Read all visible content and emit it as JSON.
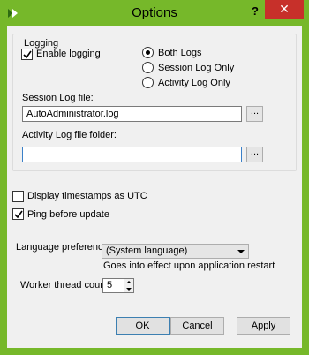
{
  "window": {
    "title": "Options",
    "help_label": "?",
    "close_label": "✕",
    "app_icon": "app-icon",
    "frame_color": "#76b82a",
    "close_color": "#c7302a"
  },
  "logging": {
    "group_title": "Logging",
    "enable_label": "Enable logging",
    "enable_checked": true,
    "radios": [
      {
        "label": "Both Logs",
        "selected": true
      },
      {
        "label": "Session Log Only",
        "selected": false
      },
      {
        "label": "Activity Log Only",
        "selected": false
      }
    ],
    "session_label": "Session Log file:",
    "session_value": "AutoAdministrator.log",
    "activity_label": "Activity Log file folder:",
    "activity_value": "",
    "browse_label": "..."
  },
  "options": {
    "utc_label": "Display timestamps as UTC",
    "utc_checked": false,
    "ping_label": "Ping before update",
    "ping_checked": true,
    "language_label": "Language preference:",
    "language_value": "(System language)",
    "language_note": "Goes into effect upon application restart",
    "worker_label": "Worker thread count:",
    "worker_value": "5"
  },
  "buttons": {
    "ok": "OK",
    "cancel": "Cancel",
    "apply": "Apply"
  }
}
